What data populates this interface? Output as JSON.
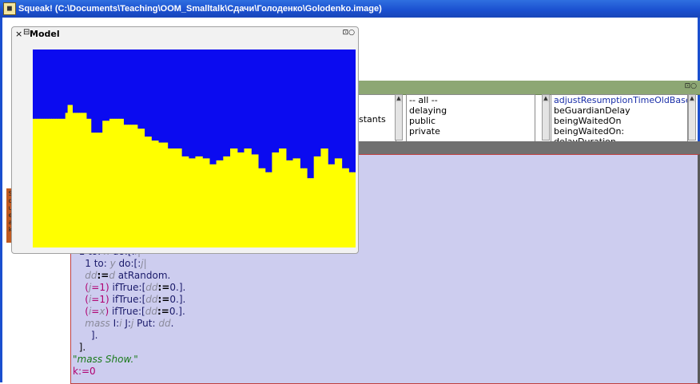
{
  "window": {
    "title": "Squeak! (C:\\Documents\\Teaching\\OOM_Smalltalk\\Сдачи\\Голоденко\\Golodenko.image)",
    "icon": "squeak-app-icon"
  },
  "model_window": {
    "title": "Model",
    "close_glyph": "×",
    "menu_glyph": "⊟",
    "right_glyphs": "⊡○"
  },
  "browser": {
    "right_glyphs": "⊡○",
    "class_pane_visible_text": "nstants",
    "category_pane": [
      "-- all --",
      "delaying",
      "public",
      "private"
    ],
    "method_pane": [
      "adjustResumptionTimeOldBase",
      "beGuardianDelay",
      "beingWaitedOn",
      "beingWaitedOn:",
      "delayDuration"
    ],
    "method_selected_index": 0
  },
  "flap": {
    "label": "Squeak"
  },
  "code": {
    "l1_a": "1 to: ",
    "l1_x": "x",
    "l1_b": " do:[:",
    "l1_i": "i",
    "l1_c": "|",
    "l2_a": "1 to: ",
    "l2_y": "y",
    "l2_b": " do:[:",
    "l2_j": "j",
    "l2_c": "|",
    "l3_dd": "dd",
    "l3_assign": ":=",
    "l3_d": "d",
    "l3_rest": " atRandom.",
    "l4_open": "(",
    "l4_v": "j",
    "l4_eq": "=1",
    "l4_close": ")",
    "l4_rest": " ifTrue:[",
    "l4_dd": "dd",
    "l4_assign": ":=",
    "l4_end": "0.].",
    "l5_open": "(",
    "l5_v": "i",
    "l5_eq": "=1",
    "l5_close": ")",
    "l5_rest": " ifTrue:[",
    "l5_dd": "dd",
    "l5_assign": ":=",
    "l5_end": "0.].",
    "l6_open": "(",
    "l6_v": "i",
    "l6_eq": "=",
    "l6_x": "x",
    "l6_close": ")",
    "l6_rest": " ifTrue:[",
    "l6_dd": "dd",
    "l6_assign": ":=",
    "l6_end": "0.].",
    "l7_mass": "mass",
    "l7_a": " I:",
    "l7_i": "i",
    "l7_b": " J:",
    "l7_j": "j",
    "l7_c": " Put: ",
    "l7_dd": "dd",
    "l7_end": ".",
    "l8": "].",
    "l9": "].",
    "l10": "\"mass Show.\"",
    "l11": "k:=0"
  },
  "colors": {
    "sky": "#0b0bf0",
    "ground": "#ffff00",
    "code_bg": "#cdcdef",
    "titlebar": "#1a4fcf",
    "browser_bar": "#8da774"
  },
  "terrain_heights": [
    0.65,
    0.65,
    0.65,
    0.65,
    0.65,
    0.65,
    0.65,
    0.65,
    0.65,
    0.65,
    0.65,
    0.65,
    0.65,
    0.65,
    0.68,
    0.72,
    0.72,
    0.68,
    0.68,
    0.68,
    0.68,
    0.68,
    0.68,
    0.65,
    0.65,
    0.58,
    0.58,
    0.58,
    0.58,
    0.58,
    0.64,
    0.64,
    0.64,
    0.65,
    0.65,
    0.65,
    0.65,
    0.65,
    0.65,
    0.62,
    0.62,
    0.62,
    0.62,
    0.62,
    0.62,
    0.6,
    0.6,
    0.6,
    0.56,
    0.56,
    0.56,
    0.54,
    0.54,
    0.54,
    0.53,
    0.53,
    0.53,
    0.53,
    0.5,
    0.5,
    0.5,
    0.5,
    0.5,
    0.5,
    0.46,
    0.46,
    0.46,
    0.45,
    0.45,
    0.45,
    0.46,
    0.46,
    0.46,
    0.45,
    0.45,
    0.45,
    0.42,
    0.42,
    0.42,
    0.44,
    0.44,
    0.44,
    0.46,
    0.46,
    0.46,
    0.5,
    0.5,
    0.5,
    0.48,
    0.48,
    0.48,
    0.5,
    0.5,
    0.5,
    0.47,
    0.47,
    0.47,
    0.4,
    0.4,
    0.4,
    0.38,
    0.38,
    0.38,
    0.48,
    0.48,
    0.48,
    0.5,
    0.5,
    0.5,
    0.44,
    0.44,
    0.44,
    0.45,
    0.45,
    0.45,
    0.4,
    0.4,
    0.4,
    0.35,
    0.35,
    0.35,
    0.46,
    0.46,
    0.46,
    0.5,
    0.5,
    0.5,
    0.42,
    0.42,
    0.42,
    0.45,
    0.45,
    0.45,
    0.4,
    0.4,
    0.4,
    0.38,
    0.38,
    0.38
  ]
}
